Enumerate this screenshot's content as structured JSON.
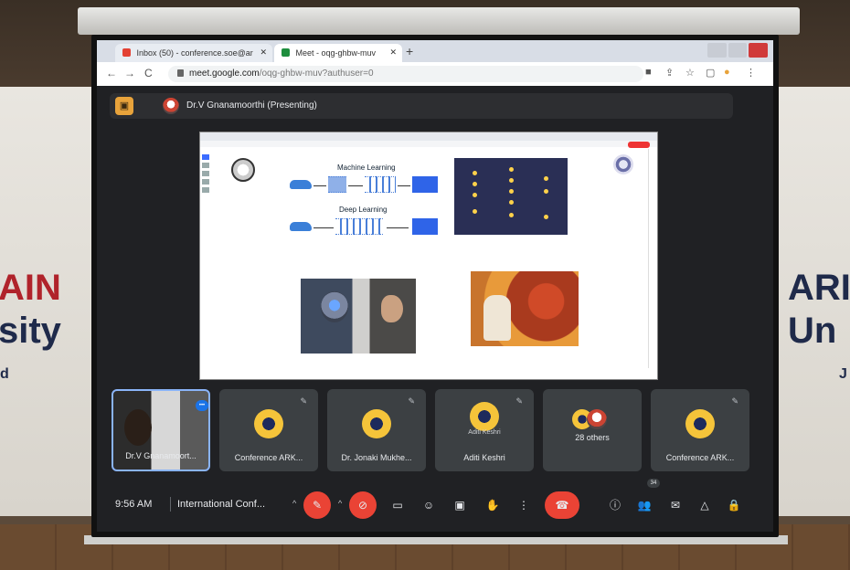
{
  "banners": {
    "left_big": "AIN",
    "left_line2": "sity",
    "left_line3": "d",
    "right_big": "ARI",
    "right_line2": "Un",
    "right_line3": "J"
  },
  "browser": {
    "tabs": [
      {
        "label": "Inbox (50) - conference.soe@ar"
      },
      {
        "label": "Meet - oqg-ghbw-muv"
      }
    ],
    "url_host": "meet.google.com",
    "url_path": "/oqg-ghbw-muv?authuser=0"
  },
  "meet": {
    "presenter_label": "Dr.V Gnanamoorthi (Presenting)",
    "slide": {
      "title_ml": "Machine Learning",
      "title_dl": "Deep Learning"
    },
    "participants": [
      {
        "name": "Dr.V Gnanamoort...",
        "sub": ""
      },
      {
        "name": "Conference ARK...",
        "sub": ""
      },
      {
        "name": "Dr. Jonaki Mukhe...",
        "sub": ""
      },
      {
        "name": "Aditi Keshri",
        "sub": "Aditi Keshri"
      },
      {
        "name": "28 others",
        "sub": ""
      },
      {
        "name": "Conference ARK...",
        "sub": ""
      }
    ],
    "time": "9:56 AM",
    "meeting_name": "International Conf...",
    "people_count": "34"
  },
  "colors": {
    "end_call": "#ea4335",
    "meet_bg": "#202124",
    "avatar_yellow": "#f5c43a"
  }
}
